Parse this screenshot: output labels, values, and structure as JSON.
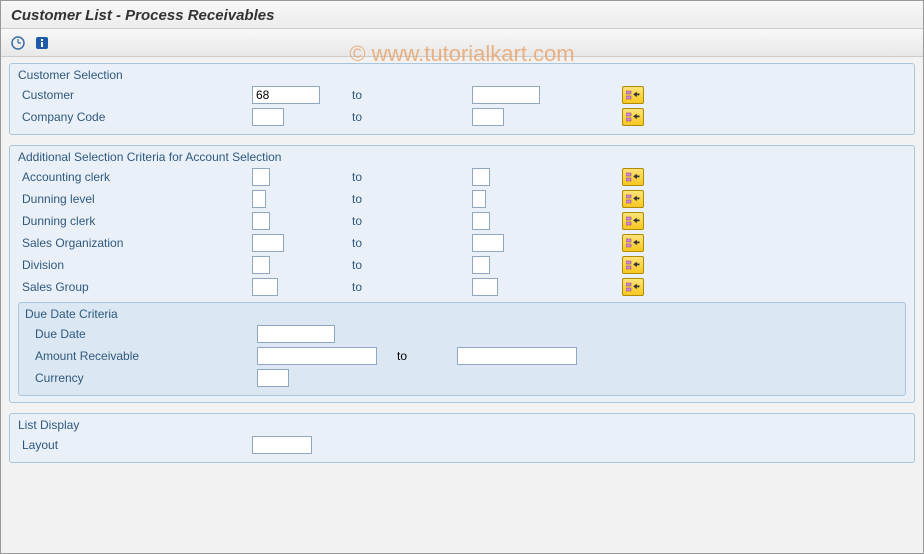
{
  "title": "Customer List - Process Receivables",
  "watermark": "© www.tutorialkart.com",
  "labels": {
    "to": "to"
  },
  "groups": {
    "customer_selection": {
      "title": "Customer Selection",
      "fields": {
        "customer": {
          "label": "Customer",
          "from": "68",
          "to": ""
        },
        "company_code": {
          "label": "Company Code",
          "from": "",
          "to": ""
        }
      }
    },
    "additional": {
      "title": "Additional Selection Criteria for Account Selection",
      "fields": {
        "accounting_clerk": {
          "label": "Accounting clerk",
          "from": "",
          "to": ""
        },
        "dunning_level": {
          "label": "Dunning level",
          "from": "",
          "to": ""
        },
        "dunning_clerk": {
          "label": "Dunning clerk",
          "from": "",
          "to": ""
        },
        "sales_org": {
          "label": "Sales Organization",
          "from": "",
          "to": ""
        },
        "division": {
          "label": "Division",
          "from": "",
          "to": ""
        },
        "sales_group": {
          "label": "Sales Group",
          "from": "",
          "to": ""
        }
      },
      "due_date": {
        "title": "Due Date Criteria",
        "fields": {
          "due_date": {
            "label": "Due Date",
            "value": ""
          },
          "amount_receivable": {
            "label": "Amount Receivable",
            "from": "",
            "to": ""
          },
          "currency": {
            "label": "Currency",
            "value": ""
          }
        }
      }
    },
    "list_display": {
      "title": "List Display",
      "fields": {
        "layout": {
          "label": "Layout",
          "value": ""
        }
      }
    }
  }
}
